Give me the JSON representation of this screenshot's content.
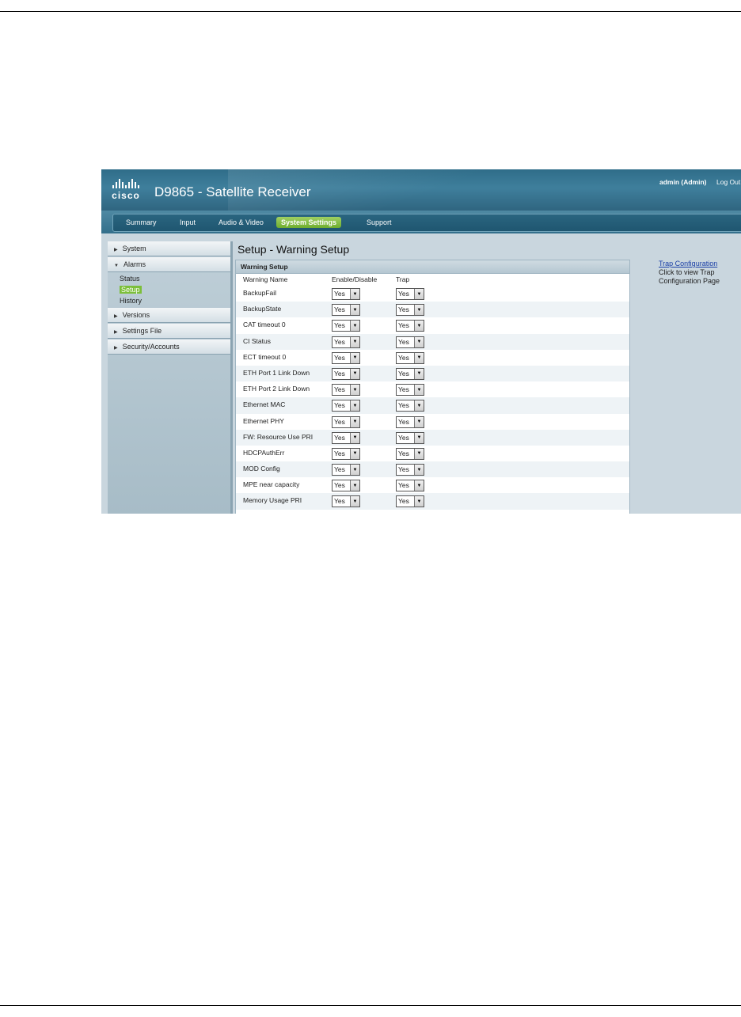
{
  "header": {
    "brand": "cisco",
    "title": "D9865 - Satellite Receiver",
    "user": "admin (Admin)",
    "logout": "Log Out"
  },
  "nav": {
    "tabs": [
      {
        "label": "Summary"
      },
      {
        "label": "Input"
      },
      {
        "label": "Audio & Video"
      },
      {
        "label": "System Settings",
        "active": true
      },
      {
        "label": "Support"
      }
    ]
  },
  "sidebar": {
    "sections": [
      {
        "label": "System"
      },
      {
        "label": "Alarms",
        "expanded": true,
        "items": [
          "Status",
          "Setup",
          "History"
        ],
        "active_item": "Setup"
      },
      {
        "label": "Versions"
      },
      {
        "label": "Settings File"
      },
      {
        "label": "Security/Accounts"
      }
    ]
  },
  "main": {
    "title": "Setup - Warning Setup",
    "panel_title": "Warning Setup",
    "columns": [
      "Warning Name",
      "Enable/Disable",
      "Trap"
    ],
    "rows": [
      {
        "name": "BackupFail",
        "enable": "Yes",
        "trap": "Yes"
      },
      {
        "name": "BackupState",
        "enable": "Yes",
        "trap": "Yes"
      },
      {
        "name": "CAT timeout 0",
        "enable": "Yes",
        "trap": "Yes"
      },
      {
        "name": "CI Status",
        "enable": "Yes",
        "trap": "Yes"
      },
      {
        "name": "ECT timeout 0",
        "enable": "Yes",
        "trap": "Yes"
      },
      {
        "name": "ETH Port 1 Link Down",
        "enable": "Yes",
        "trap": "Yes"
      },
      {
        "name": "ETH Port 2 Link Down",
        "enable": "Yes",
        "trap": "Yes"
      },
      {
        "name": "Ethernet MAC",
        "enable": "Yes",
        "trap": "Yes"
      },
      {
        "name": "Ethernet PHY",
        "enable": "Yes",
        "trap": "Yes"
      },
      {
        "name": "FW: Resource Use PRI",
        "enable": "Yes",
        "trap": "Yes"
      },
      {
        "name": "HDCPAuthErr",
        "enable": "Yes",
        "trap": "Yes"
      },
      {
        "name": "MOD Config",
        "enable": "Yes",
        "trap": "Yes"
      },
      {
        "name": "MPE near capacity",
        "enable": "Yes",
        "trap": "Yes"
      },
      {
        "name": "Memory Usage PRI",
        "enable": "Yes",
        "trap": "Yes"
      }
    ]
  },
  "right": {
    "link": "Trap Configuration",
    "description": "Click to view Trap Configuration Page"
  },
  "colors": {
    "accent_green": "#7cbf3a",
    "header_blue": "#2f6d89",
    "link_blue": "#1a3fa6"
  }
}
